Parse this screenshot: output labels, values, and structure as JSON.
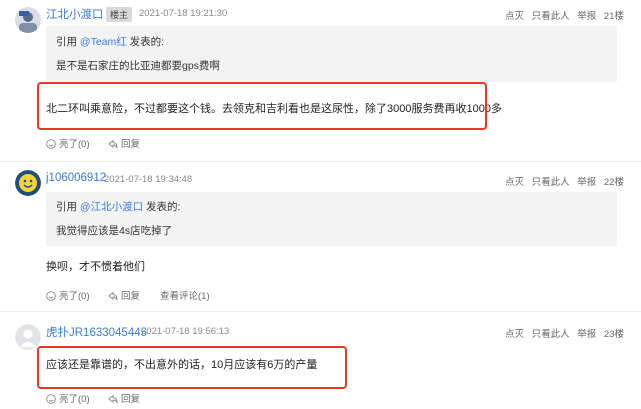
{
  "posts": [
    {
      "username": "江北小渡口",
      "badge": "楼主",
      "time": "2021-07-18 19:21:30",
      "actions": [
        "点灭",
        "只看此人",
        "举报"
      ],
      "floor": "21楼",
      "quote_prefix": "引用 ",
      "quote_user": "@Team红",
      "quote_suffix": " 发表的:",
      "quote_text": "是不是石家庄的比亚迪都要gps费啊",
      "content": "北二环叫乘意险，不过都要这个钱。去领克和吉利看也是这尿性，除了3000服务费再收1000多",
      "likes": "亮了(0)",
      "reply": "回复"
    },
    {
      "username": "j106006912",
      "time": "2021-07-18 19:34:48",
      "actions": [
        "点灭",
        "只看此人",
        "举报"
      ],
      "floor": "22楼",
      "quote_prefix": "引用 ",
      "quote_user": "@江北小渡口",
      "quote_suffix": " 发表的:",
      "quote_text": "我觉得应该是4s店吃掉了",
      "content": "换呗，才不惯着他们",
      "likes": "亮了(0)",
      "reply": "回复",
      "view_comments": "查看评论(1)"
    },
    {
      "username": "虎扑JR1633045445",
      "time": "2021-07-18 19:56:13",
      "actions": [
        "点灭",
        "只看此人",
        "举报"
      ],
      "floor": "23楼",
      "content": "应该还是靠谱的，不出意外的话，10月应该有6万的产量",
      "likes": "亮了(0)",
      "reply": "回复"
    }
  ],
  "colors": {
    "link": "#3a7bd5",
    "highlight_box": "#e23b2a",
    "quote_bg": "#f3f3f3"
  },
  "icons": [
    "avatar-jiangbei",
    "avatar-smiley",
    "avatar-default",
    "like-icon",
    "reply-icon"
  ]
}
